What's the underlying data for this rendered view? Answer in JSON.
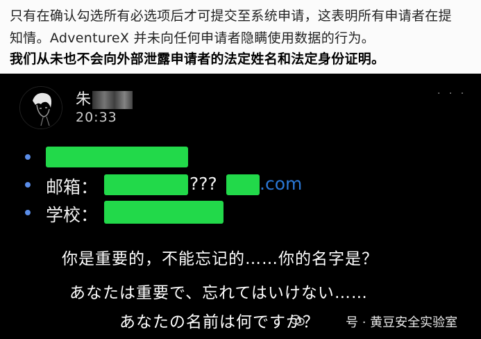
{
  "article": {
    "line1": "只有在确认勾选所有必选项后才可提交至系统申请，这表明所有申请者在提",
    "line2": "知情。AdventureX 并未向任何申请者隐瞒使用数据的行为。",
    "line3": "我们从未也不会向外部泄露申请者的法定姓名和法定身份证明。"
  },
  "chat": {
    "name_visible": "朱",
    "time": "20:33",
    "more_label": "· · ·"
  },
  "form": {
    "email_label": "邮箱：",
    "email_mid": "???",
    "email_suffix": ".com",
    "school_label": "学校：",
    "bullet_color": "#5a8de8",
    "redaction_color": "#22d94a"
  },
  "subtitles": {
    "zh": "你是重要的，不能忘记的……你的名字是？",
    "ja1": "あなたは重要で、忘れてはいけない……",
    "ja2": "あなたの名前は何ですか？"
  },
  "watermark": {
    "text": "号 · 黄豆安全实验室"
  }
}
